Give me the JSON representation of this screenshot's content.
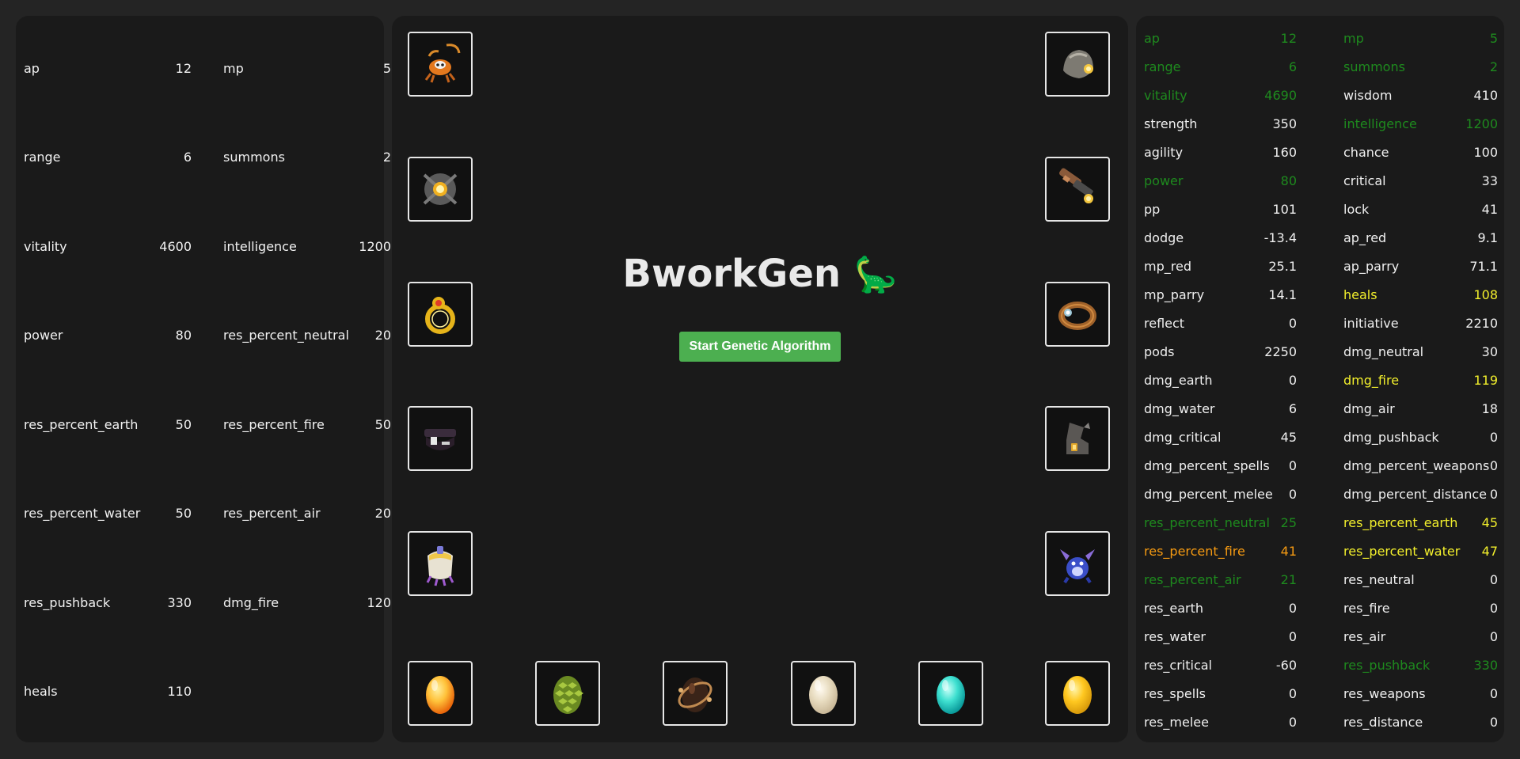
{
  "target_stats": [
    {
      "key": "ap",
      "value": "12"
    },
    {
      "key": "mp",
      "value": "5"
    },
    {
      "key": "range",
      "value": "6"
    },
    {
      "key": "summons",
      "value": "2"
    },
    {
      "key": "vitality",
      "value": "4600"
    },
    {
      "key": "intelligence",
      "value": "1200"
    },
    {
      "key": "power",
      "value": "80"
    },
    {
      "key": "res_percent_neutral",
      "value": "20"
    },
    {
      "key": "res_percent_earth",
      "value": "50"
    },
    {
      "key": "res_percent_fire",
      "value": "50"
    },
    {
      "key": "res_percent_water",
      "value": "50"
    },
    {
      "key": "res_percent_air",
      "value": "20"
    },
    {
      "key": "res_pushback",
      "value": "330"
    },
    {
      "key": "dmg_fire",
      "value": "120"
    },
    {
      "key": "heals",
      "value": "110"
    }
  ],
  "main": {
    "title": "BworkGen",
    "title_emoji": "🦕",
    "start_label": "Start Genetic Algorithm",
    "accent": "#4caf50"
  },
  "equipment_slots": [
    {
      "icon": "amulet-crab-icon"
    },
    {
      "icon": "helmet-icon"
    },
    {
      "icon": "shield-icon"
    },
    {
      "icon": "weapon-hammer-icon"
    },
    {
      "icon": "ring-left-icon"
    },
    {
      "icon": "ring-right-icon"
    },
    {
      "icon": "belt-icon"
    },
    {
      "icon": "boots-icon"
    },
    {
      "icon": "cape-icon"
    },
    {
      "icon": "pet-icon"
    },
    {
      "icon": "dofus-fire-egg-icon"
    },
    {
      "icon": "dofus-cone-egg-icon"
    },
    {
      "icon": "dofus-dark-egg-icon"
    },
    {
      "icon": "dofus-ivory-egg-icon"
    },
    {
      "icon": "dofus-turquoise-egg-icon"
    },
    {
      "icon": "dofus-golden-egg-icon"
    }
  ],
  "computed_stats": [
    {
      "key": "ap",
      "value": "12",
      "color": "green"
    },
    {
      "key": "mp",
      "value": "5",
      "color": "green"
    },
    {
      "key": "range",
      "value": "6",
      "color": "green"
    },
    {
      "key": "summons",
      "value": "2",
      "color": "green"
    },
    {
      "key": "vitality",
      "value": "4690",
      "color": "green"
    },
    {
      "key": "wisdom",
      "value": "410",
      "color": "white"
    },
    {
      "key": "strength",
      "value": "350",
      "color": "white"
    },
    {
      "key": "intelligence",
      "value": "1200",
      "color": "green"
    },
    {
      "key": "agility",
      "value": "160",
      "color": "white"
    },
    {
      "key": "chance",
      "value": "100",
      "color": "white"
    },
    {
      "key": "power",
      "value": "80",
      "color": "green"
    },
    {
      "key": "critical",
      "value": "33",
      "color": "white"
    },
    {
      "key": "pp",
      "value": "101",
      "color": "white"
    },
    {
      "key": "lock",
      "value": "41",
      "color": "white"
    },
    {
      "key": "dodge",
      "value": "-13.4",
      "color": "white"
    },
    {
      "key": "ap_red",
      "value": "9.1",
      "color": "white"
    },
    {
      "key": "mp_red",
      "value": "25.1",
      "color": "white"
    },
    {
      "key": "ap_parry",
      "value": "71.1",
      "color": "white"
    },
    {
      "key": "mp_parry",
      "value": "14.1",
      "color": "white"
    },
    {
      "key": "heals",
      "value": "108",
      "color": "yellow"
    },
    {
      "key": "reflect",
      "value": "0",
      "color": "white"
    },
    {
      "key": "initiative",
      "value": "2210",
      "color": "white"
    },
    {
      "key": "pods",
      "value": "2250",
      "color": "white"
    },
    {
      "key": "dmg_neutral",
      "value": "30",
      "color": "white"
    },
    {
      "key": "dmg_earth",
      "value": "0",
      "color": "white"
    },
    {
      "key": "dmg_fire",
      "value": "119",
      "color": "yellow"
    },
    {
      "key": "dmg_water",
      "value": "6",
      "color": "white"
    },
    {
      "key": "dmg_air",
      "value": "18",
      "color": "white"
    },
    {
      "key": "dmg_critical",
      "value": "45",
      "color": "white"
    },
    {
      "key": "dmg_pushback",
      "value": "0",
      "color": "white"
    },
    {
      "key": "dmg_percent_spells",
      "value": "0",
      "color": "white"
    },
    {
      "key": "dmg_percent_weapons",
      "value": "0",
      "color": "white"
    },
    {
      "key": "dmg_percent_melee",
      "value": "0",
      "color": "white"
    },
    {
      "key": "dmg_percent_distance",
      "value": "0",
      "color": "white"
    },
    {
      "key": "res_percent_neutral",
      "value": "25",
      "color": "green"
    },
    {
      "key": "res_percent_earth",
      "value": "45",
      "color": "yellow"
    },
    {
      "key": "res_percent_fire",
      "value": "41",
      "color": "orange"
    },
    {
      "key": "res_percent_water",
      "value": "47",
      "color": "yellow"
    },
    {
      "key": "res_percent_air",
      "value": "21",
      "color": "green"
    },
    {
      "key": "res_neutral",
      "value": "0",
      "color": "white"
    },
    {
      "key": "res_earth",
      "value": "0",
      "color": "white"
    },
    {
      "key": "res_fire",
      "value": "0",
      "color": "white"
    },
    {
      "key": "res_water",
      "value": "0",
      "color": "white"
    },
    {
      "key": "res_air",
      "value": "0",
      "color": "white"
    },
    {
      "key": "res_critical",
      "value": "-60",
      "color": "white"
    },
    {
      "key": "res_pushback",
      "value": "330",
      "color": "green"
    },
    {
      "key": "res_spells",
      "value": "0",
      "color": "white"
    },
    {
      "key": "res_weapons",
      "value": "0",
      "color": "white"
    },
    {
      "key": "res_melee",
      "value": "0",
      "color": "white"
    },
    {
      "key": "res_distance",
      "value": "0",
      "color": "white"
    }
  ]
}
